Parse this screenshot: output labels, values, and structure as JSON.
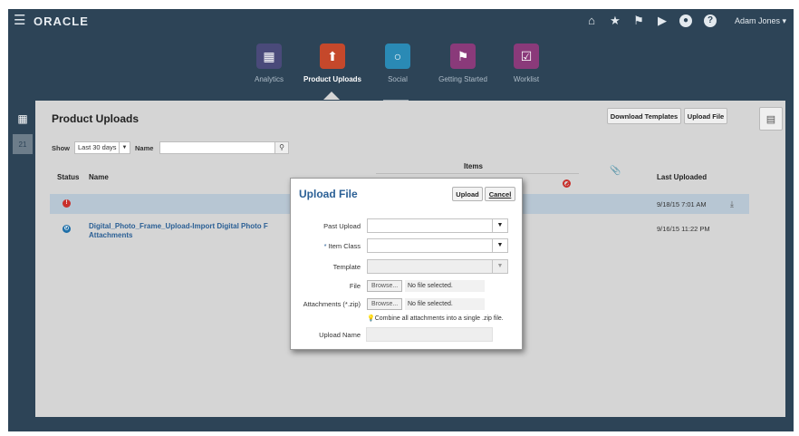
{
  "header": {
    "logo": "ORACLE",
    "user": "Adam Jones ▾"
  },
  "nav": [
    {
      "label": "Analytics",
      "color": "#4a4a7a",
      "icon": "analytics-icon"
    },
    {
      "label": "Product Uploads",
      "color": "#c5482b",
      "icon": "upload-icon",
      "active": true
    },
    {
      "label": "Social",
      "color": "#2a8ab5",
      "icon": "social-icon"
    },
    {
      "label": "Getting Started",
      "color": "#8a3a7a",
      "icon": "flag-icon"
    },
    {
      "label": "Worklist",
      "color": "#8a3a7a",
      "icon": "clipboard-icon"
    }
  ],
  "panel": {
    "title": "Product Uploads",
    "download_templates": "Download Templates",
    "upload_file": "Upload File",
    "filter": {
      "show_label": "Show",
      "show_value": "Last 30 days",
      "name_label": "Name",
      "name_value": ""
    },
    "columns": {
      "status": "Status",
      "name": "Name",
      "items": "Items",
      "last_uploaded": "Last Uploaded"
    },
    "rows": [
      {
        "status": "error",
        "name": "",
        "date": "9/18/15 7:01 AM"
      },
      {
        "status": "info",
        "name": "Digital_Photo_Frame_Upload-Import Digital Photo F Attachments",
        "date": "9/16/15 11:22 PM"
      }
    ]
  },
  "dialog": {
    "title": "Upload File",
    "upload": "Upload",
    "cancel": "Cancel",
    "past_upload_label": "Past Upload",
    "item_class_label": "Item Class",
    "required_mark": "*",
    "template_label": "Template",
    "file_label": "File",
    "attachments_label": "Attachments (*.zip)",
    "browse": "Browse...",
    "no_file": "No file selected.",
    "hint": "Combine all attachments into a single .zip file.",
    "upload_name_label": "Upload Name"
  },
  "colors": {
    "background": "#2d4457",
    "panel": "#d5d5d5",
    "selected_row": "#b7c6d3",
    "link": "#2a5f95",
    "error": "#c9302c",
    "info": "#1f6fa8"
  }
}
